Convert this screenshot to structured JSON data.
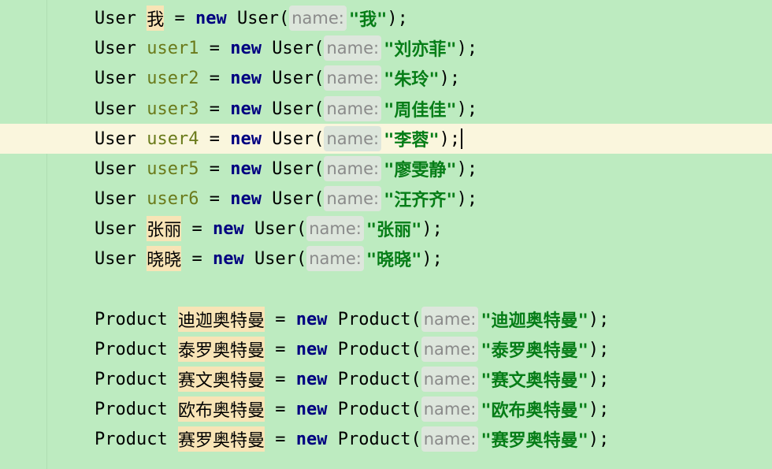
{
  "editor": {
    "keyword_new": "new",
    "hint_label": "name:",
    "lines": [
      {
        "type": "User",
        "var": "我",
        "var_kind": "hl",
        "ctor": "User",
        "arg": "\"我\"",
        "current": false
      },
      {
        "type": "User",
        "var": "user1",
        "var_kind": "var",
        "ctor": "User",
        "arg": "\"刘亦菲\"",
        "current": false
      },
      {
        "type": "User",
        "var": "user2",
        "var_kind": "var",
        "ctor": "User",
        "arg": "\"朱玲\"",
        "current": false
      },
      {
        "type": "User",
        "var": "user3",
        "var_kind": "var",
        "ctor": "User",
        "arg": "\"周佳佳\"",
        "current": false
      },
      {
        "type": "User",
        "var": "user4",
        "var_kind": "var",
        "ctor": "User",
        "arg": "\"李蓉\"",
        "current": true
      },
      {
        "type": "User",
        "var": "user5",
        "var_kind": "var",
        "ctor": "User",
        "arg": "\"廖雯静\"",
        "current": false
      },
      {
        "type": "User",
        "var": "user6",
        "var_kind": "var",
        "ctor": "User",
        "arg": "\"汪齐齐\"",
        "current": false
      },
      {
        "type": "User",
        "var": "张丽",
        "var_kind": "hl",
        "ctor": "User",
        "arg": "\"张丽\"",
        "current": false
      },
      {
        "type": "User",
        "var": "晓晓",
        "var_kind": "hl",
        "ctor": "User",
        "arg": "\"晓晓\"",
        "current": false
      },
      {
        "type": "Product",
        "var": "迪迦奥特曼",
        "var_kind": "hl",
        "ctor": "Product",
        "arg": "\"迪迦奥特曼\"",
        "current": false
      },
      {
        "type": "Product",
        "var": "泰罗奥特曼",
        "var_kind": "hl",
        "ctor": "Product",
        "arg": "\"泰罗奥特曼\"",
        "current": false
      },
      {
        "type": "Product",
        "var": "赛文奥特曼",
        "var_kind": "hl",
        "ctor": "Product",
        "arg": "\"赛文奥特曼\"",
        "current": false
      },
      {
        "type": "Product",
        "var": "欧布奥特曼",
        "var_kind": "hl",
        "ctor": "Product",
        "arg": "\"欧布奥特曼\"",
        "current": false
      },
      {
        "type": "Product",
        "var": "赛罗奥特曼",
        "var_kind": "hl",
        "ctor": "Product",
        "arg": "\"赛罗奥特曼\"",
        "current": false
      }
    ]
  },
  "colors": {
    "background": "#BDEBC0",
    "current_line": "#FAF6DD",
    "keyword": "#000080",
    "variable": "#6A7A1A",
    "string": "#067D17",
    "highlight": "#F8E4B6",
    "hint_bg": "#DDE6DC"
  }
}
